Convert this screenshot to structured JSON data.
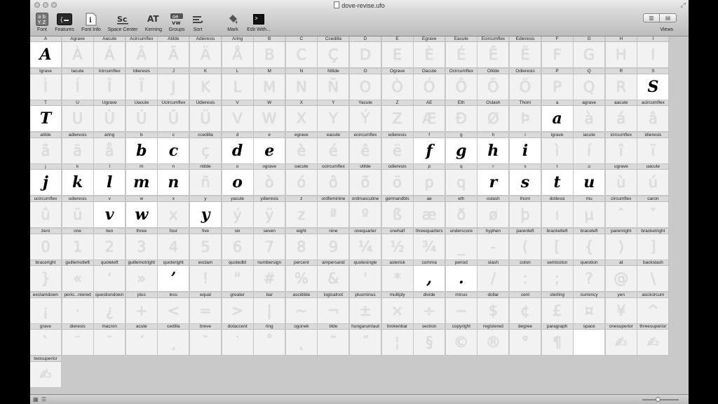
{
  "window": {
    "title": "dove-revise.ufo"
  },
  "toolbar": {
    "items": [
      {
        "label": "Font",
        "icon": "font-icon"
      },
      {
        "label": "Features",
        "icon": "features-icon"
      },
      {
        "label": "Font Info",
        "icon": "info-icon"
      },
      {
        "label": "Space Center",
        "icon": "space-center-icon"
      },
      {
        "label": "Kerning",
        "icon": "kerning-icon"
      },
      {
        "label": "Groups",
        "icon": "groups-icon"
      },
      {
        "label": "Sort",
        "icon": "sort-icon"
      },
      {
        "label": "Mark",
        "icon": "paint-bucket-icon"
      },
      {
        "label": "Edit With...",
        "icon": "terminal-icon"
      }
    ],
    "views_label": "Views"
  },
  "glyphs": [
    {
      "name": "A",
      "char": "A",
      "filled": true
    },
    {
      "name": "Agrave",
      "char": "À"
    },
    {
      "name": "Aacute",
      "char": "Á"
    },
    {
      "name": "Acircumflex",
      "char": "Â"
    },
    {
      "name": "Atilde",
      "char": "Ã"
    },
    {
      "name": "Adieresis",
      "char": "Ä"
    },
    {
      "name": "Aring",
      "char": "Å"
    },
    {
      "name": "B",
      "char": "B"
    },
    {
      "name": "C",
      "char": "C"
    },
    {
      "name": "Ccedilla",
      "char": "Ç"
    },
    {
      "name": "D",
      "char": "D"
    },
    {
      "name": "E",
      "char": "E"
    },
    {
      "name": "Egrave",
      "char": "È"
    },
    {
      "name": "Eacute",
      "char": "É"
    },
    {
      "name": "Ecircumflex",
      "char": "Ê"
    },
    {
      "name": "Edieresis",
      "char": "Ë"
    },
    {
      "name": "F",
      "char": "F"
    },
    {
      "name": "G",
      "char": "G"
    },
    {
      "name": "H",
      "char": "H"
    },
    {
      "name": "I",
      "char": "I"
    },
    {
      "name": "Igrave",
      "char": "Ì"
    },
    {
      "name": "Iacute",
      "char": "Í"
    },
    {
      "name": "Icircumflex",
      "char": "Î"
    },
    {
      "name": "Idieresis",
      "char": "Ï"
    },
    {
      "name": "J",
      "char": "J"
    },
    {
      "name": "K",
      "char": "K"
    },
    {
      "name": "L",
      "char": "L"
    },
    {
      "name": "M",
      "char": "M"
    },
    {
      "name": "N",
      "char": "N"
    },
    {
      "name": "Ntilde",
      "char": "Ñ"
    },
    {
      "name": "O",
      "char": "O"
    },
    {
      "name": "Ograve",
      "char": "Ò"
    },
    {
      "name": "Oacute",
      "char": "Ó"
    },
    {
      "name": "Ocircumflex",
      "char": "Ô"
    },
    {
      "name": "Otilde",
      "char": "Õ"
    },
    {
      "name": "Odieresis",
      "char": "Ö"
    },
    {
      "name": "P",
      "char": "P"
    },
    {
      "name": "Q",
      "char": "Q"
    },
    {
      "name": "R",
      "char": "R"
    },
    {
      "name": "S",
      "char": "S",
      "filled": true
    },
    {
      "name": "T",
      "char": "T",
      "filled": true
    },
    {
      "name": "U",
      "char": "U"
    },
    {
      "name": "Ugrave",
      "char": "Ù"
    },
    {
      "name": "Uacute",
      "char": "Ú"
    },
    {
      "name": "Ucircumflex",
      "char": "Û"
    },
    {
      "name": "Udieresis",
      "char": "Ü"
    },
    {
      "name": "V",
      "char": "V"
    },
    {
      "name": "W",
      "char": "W"
    },
    {
      "name": "X",
      "char": "X"
    },
    {
      "name": "Y",
      "char": "Y"
    },
    {
      "name": "Yacute",
      "char": "Ý"
    },
    {
      "name": "Z",
      "char": "Z"
    },
    {
      "name": "AE",
      "char": "Æ"
    },
    {
      "name": "Eth",
      "char": "Ð"
    },
    {
      "name": "Oslash",
      "char": "Ø"
    },
    {
      "name": "Thorn",
      "char": "Þ"
    },
    {
      "name": "a",
      "char": "a",
      "filled": true
    },
    {
      "name": "agrave",
      "char": "à"
    },
    {
      "name": "aacute",
      "char": "á"
    },
    {
      "name": "acircumflex",
      "char": "â"
    },
    {
      "name": "atilde",
      "char": "ã"
    },
    {
      "name": "adieresis",
      "char": "ä"
    },
    {
      "name": "aring",
      "char": "å"
    },
    {
      "name": "b",
      "char": "b",
      "filled": true
    },
    {
      "name": "c",
      "char": "c",
      "filled": true
    },
    {
      "name": "ccedilla",
      "char": "ç"
    },
    {
      "name": "d",
      "char": "d",
      "filled": true
    },
    {
      "name": "e",
      "char": "e",
      "filled": true
    },
    {
      "name": "egrave",
      "char": "è"
    },
    {
      "name": "eacute",
      "char": "é"
    },
    {
      "name": "ecircumflex",
      "char": "ê"
    },
    {
      "name": "edieresis",
      "char": "ë"
    },
    {
      "name": "f",
      "char": "f",
      "filled": true
    },
    {
      "name": "g",
      "char": "g",
      "filled": true
    },
    {
      "name": "h",
      "char": "h",
      "filled": true
    },
    {
      "name": "i",
      "char": "i",
      "filled": true
    },
    {
      "name": "igrave",
      "char": "ì"
    },
    {
      "name": "iacute",
      "char": "í"
    },
    {
      "name": "icircumflex",
      "char": "î"
    },
    {
      "name": "idieresis",
      "char": "ï"
    },
    {
      "name": "j",
      "char": "j",
      "filled": true
    },
    {
      "name": "k",
      "char": "k",
      "filled": true
    },
    {
      "name": "l",
      "char": "l",
      "filled": true
    },
    {
      "name": "m",
      "char": "m",
      "filled": true
    },
    {
      "name": "n",
      "char": "n",
      "filled": true
    },
    {
      "name": "ntilde",
      "char": "ñ"
    },
    {
      "name": "o",
      "char": "o",
      "filled": true
    },
    {
      "name": "ograve",
      "char": "ò"
    },
    {
      "name": "oacute",
      "char": "ó"
    },
    {
      "name": "ocircumflex",
      "char": "ô"
    },
    {
      "name": "otilde",
      "char": "õ"
    },
    {
      "name": "odieresis",
      "char": "ö"
    },
    {
      "name": "p",
      "char": "p"
    },
    {
      "name": "q",
      "char": "q"
    },
    {
      "name": "r",
      "char": "r",
      "filled": true
    },
    {
      "name": "s",
      "char": "s",
      "filled": true
    },
    {
      "name": "t",
      "char": "t",
      "filled": true
    },
    {
      "name": "u",
      "char": "u",
      "filled": true
    },
    {
      "name": "ugrave",
      "char": "ù"
    },
    {
      "name": "uacute",
      "char": "ú"
    },
    {
      "name": "ucircumflex",
      "char": "û"
    },
    {
      "name": "udieresis",
      "char": "ü"
    },
    {
      "name": "v",
      "char": "v",
      "filled": true
    },
    {
      "name": "w",
      "char": "w",
      "filled": true
    },
    {
      "name": "x",
      "char": "x"
    },
    {
      "name": "y",
      "char": "y",
      "filled": true
    },
    {
      "name": "yacute",
      "char": "ý"
    },
    {
      "name": "ydieresis",
      "char": "ÿ"
    },
    {
      "name": "z",
      "char": "z"
    },
    {
      "name": "ordfeminine",
      "char": "ª"
    },
    {
      "name": "ordmasculine",
      "char": "º"
    },
    {
      "name": "germandbls",
      "char": "ß"
    },
    {
      "name": "ae",
      "char": "æ"
    },
    {
      "name": "eth",
      "char": "ð"
    },
    {
      "name": "oslash",
      "char": "ø"
    },
    {
      "name": "thorn",
      "char": "þ"
    },
    {
      "name": "dotlessi",
      "char": "ı"
    },
    {
      "name": "mu",
      "char": "µ"
    },
    {
      "name": "circumflex",
      "char": "ˆ"
    },
    {
      "name": "caron",
      "char": "ˇ"
    },
    {
      "name": "zero",
      "char": "0"
    },
    {
      "name": "one",
      "char": "1"
    },
    {
      "name": "two",
      "char": "2"
    },
    {
      "name": "three",
      "char": "3"
    },
    {
      "name": "four",
      "char": "4"
    },
    {
      "name": "five",
      "char": "5"
    },
    {
      "name": "six",
      "char": "6"
    },
    {
      "name": "seven",
      "char": "7"
    },
    {
      "name": "eight",
      "char": "8"
    },
    {
      "name": "nine",
      "char": "9"
    },
    {
      "name": "onequarter",
      "char": "¼"
    },
    {
      "name": "onehalf",
      "char": "½"
    },
    {
      "name": "threequarters",
      "char": "¾"
    },
    {
      "name": "underscore",
      "char": "_"
    },
    {
      "name": "hyphen",
      "char": "-"
    },
    {
      "name": "parenleft",
      "char": "("
    },
    {
      "name": "bracketleft",
      "char": "["
    },
    {
      "name": "braceleft",
      "char": "{"
    },
    {
      "name": "parenright",
      "char": ")"
    },
    {
      "name": "bracketright",
      "char": "]"
    },
    {
      "name": "braceright",
      "char": "}"
    },
    {
      "name": "guillemotleft",
      "char": "«"
    },
    {
      "name": "quoteleft",
      "char": "‘"
    },
    {
      "name": "guillemotright",
      "char": "»"
    },
    {
      "name": "quoteright",
      "char": "’",
      "filled": true
    },
    {
      "name": "exclam",
      "char": "!"
    },
    {
      "name": "quotedbl",
      "char": "\""
    },
    {
      "name": "numbersign",
      "char": "#"
    },
    {
      "name": "percent",
      "char": "%"
    },
    {
      "name": "ampersand",
      "char": "&"
    },
    {
      "name": "quotesingle",
      "char": "'"
    },
    {
      "name": "asterisk",
      "char": "*"
    },
    {
      "name": "comma",
      "char": ",",
      "filled": true
    },
    {
      "name": "period",
      "char": ".",
      "filled": true
    },
    {
      "name": "slash",
      "char": "/"
    },
    {
      "name": "colon",
      "char": ":"
    },
    {
      "name": "semicolon",
      "char": ";"
    },
    {
      "name": "question",
      "char": "?"
    },
    {
      "name": "at",
      "char": "@"
    },
    {
      "name": "backslash",
      "char": "\\"
    },
    {
      "name": "exclamdown",
      "char": "¡"
    },
    {
      "name": "perio...ntered",
      "char": "·"
    },
    {
      "name": "questiondown",
      "char": "¿"
    },
    {
      "name": "plus",
      "char": "+"
    },
    {
      "name": "less",
      "char": "<"
    },
    {
      "name": "equal",
      "char": "="
    },
    {
      "name": "greater",
      "char": ">"
    },
    {
      "name": "bar",
      "char": "|"
    },
    {
      "name": "asciitilde",
      "char": "~"
    },
    {
      "name": "logicalnot",
      "char": "¬"
    },
    {
      "name": "plusminus",
      "char": "±"
    },
    {
      "name": "multiply",
      "char": "×"
    },
    {
      "name": "divide",
      "char": "÷"
    },
    {
      "name": "minus",
      "char": "−"
    },
    {
      "name": "dollar",
      "char": "$"
    },
    {
      "name": "cent",
      "char": "¢"
    },
    {
      "name": "sterling",
      "char": "£"
    },
    {
      "name": "currency",
      "char": "¤"
    },
    {
      "name": "yen",
      "char": "¥"
    },
    {
      "name": "asciicircum",
      "char": "^"
    },
    {
      "name": "grave",
      "char": "`"
    },
    {
      "name": "dieresis",
      "char": "¨"
    },
    {
      "name": "macron",
      "char": "¯"
    },
    {
      "name": "acute",
      "char": "´"
    },
    {
      "name": "cedilla",
      "char": "¸"
    },
    {
      "name": "breve",
      "char": "˘"
    },
    {
      "name": "dotaccent",
      "char": "˙"
    },
    {
      "name": "ring",
      "char": "˚"
    },
    {
      "name": "ogonek",
      "char": "˛"
    },
    {
      "name": "tilde",
      "char": "˜"
    },
    {
      "name": "hungarumlaut",
      "char": "˝"
    },
    {
      "name": "brokenbar",
      "char": "¦"
    },
    {
      "name": "section",
      "char": "§"
    },
    {
      "name": "copyright",
      "char": "©"
    },
    {
      "name": "registered",
      "char": "®"
    },
    {
      "name": "degree",
      "char": "°"
    },
    {
      "name": "paragraph",
      "char": "¶"
    },
    {
      "name": "space",
      "char": "",
      "white": true
    },
    {
      "name": "onesuperior",
      "char": "✍"
    },
    {
      "name": "threesuperior",
      "char": "✍"
    },
    {
      "name": "twosuperior",
      "char": "✍"
    }
  ],
  "colors": {
    "window_bg": "#c9c9c9",
    "cell_empty": "#f2f2f2",
    "cell_filled": "#ffffff",
    "glyph_filled": "#000000",
    "glyph_template": "#dcdcdc"
  }
}
